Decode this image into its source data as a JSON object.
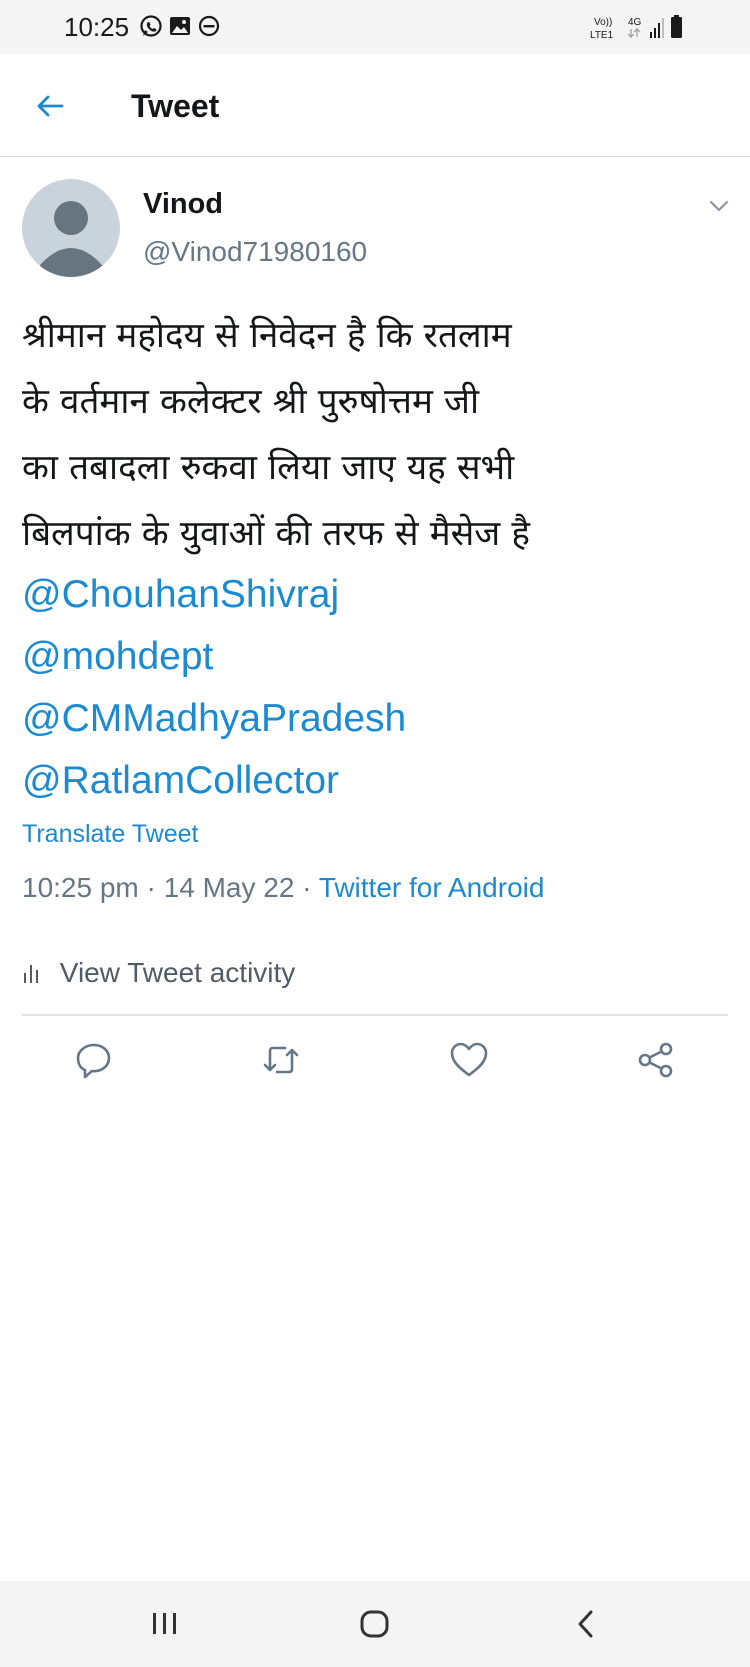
{
  "status_bar": {
    "time": "10:25",
    "left_icons": [
      "whatsapp-icon",
      "gallery-icon",
      "do-not-disturb-icon"
    ],
    "carrier_top": "Vo))",
    "carrier_bottom": "LTE1",
    "network": "4G",
    "right_icons": [
      "signal-icon",
      "battery-icon"
    ]
  },
  "app_bar": {
    "title": "Tweet",
    "back_icon": "back-arrow-icon"
  },
  "tweet": {
    "author_name": "Vinod",
    "author_handle": "@Vinod71980160",
    "text_lines": [
      "श्रीमान महोदय से निवेदन है कि रतलाम",
      "के वर्तमान कलेक्टर श्री पुरुषोत्तम जी",
      "का तबादला रुकवा लिया जाए यह सभी",
      "बिलपांक के युवाओं की तरफ से मैसेज है"
    ],
    "mentions": [
      "@ChouhanShivraj",
      "@mohdept",
      "@CMMadhyaPradesh",
      "@RatlamCollector"
    ],
    "translate_label": "Translate Tweet",
    "time": "10:25 pm",
    "date": "14 May 22",
    "source": "Twitter for Android",
    "separator": "·",
    "activity_label": "View Tweet activity"
  },
  "actions": [
    "reply-icon",
    "retweet-icon",
    "like-icon",
    "share-icon"
  ],
  "colors": {
    "accent": "#1c8ad0",
    "secondary_text": "#657786",
    "primary_text": "#14171a",
    "divider": "#dfe3e6"
  }
}
